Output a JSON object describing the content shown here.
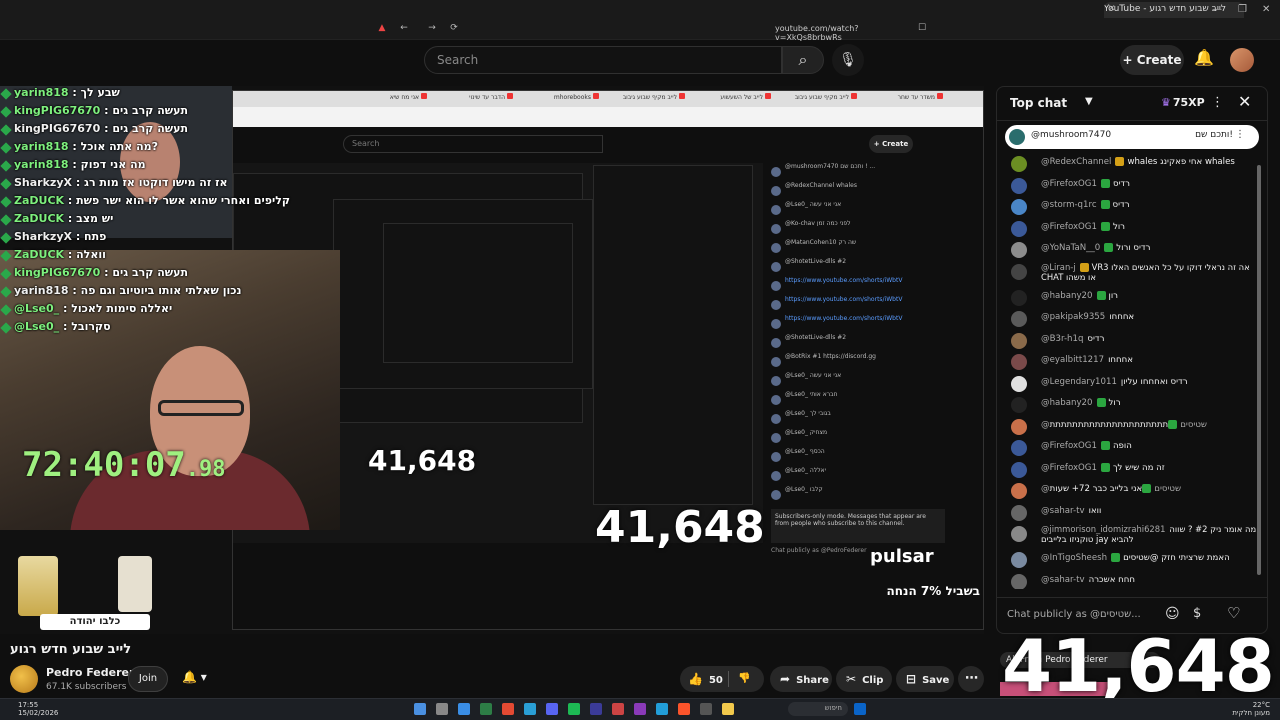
{
  "browser": {
    "tab_title": "לייב שבוע חדש רגוע - YouTube",
    "url": "youtube.com/watch?v=XkQs8brbwRs"
  },
  "masthead": {
    "search_placeholder": "Search",
    "create_label": "Create"
  },
  "video": {
    "timer_main": "72:40:07",
    "timer_frac": ".98",
    "counter_small": "41,648",
    "counter_mid": "41,648",
    "pulsar_name": "pulsar",
    "pulsar_promo": "בשביל 7% הנחה",
    "kalbi_text": "כלבו יהודה",
    "inner_search": "Search",
    "inner_create": "+ Create",
    "inner_tabs": [
      "משדר עד שחר",
      "לייב מקיף שבוע גיבוב",
      "לייב של השעשוע",
      "לייב מקיף שבוע גיבוב",
      "mhorebooks",
      "הדבר עד שינוי",
      "אני מח שיא"
    ],
    "inner_chat": [
      {
        "text": "@mushroom7470 ותכם שם ! ...",
        "kind": "pin"
      },
      {
        "text": "@RedexChannel whales",
        "kind": "normal"
      },
      {
        "text": "@Lse0_ אני אני עשה",
        "kind": "normal"
      },
      {
        "text": "@Ko-chav לפני כמה זמן",
        "kind": "normal"
      },
      {
        "text": "@MatanCohen10 שה רק",
        "kind": "normal"
      },
      {
        "text": "@ShotetLive-dlls #2",
        "kind": "normal"
      },
      {
        "text": "https://www.youtube.com/shorts/iWbtV",
        "kind": "link"
      },
      {
        "text": "https://www.youtube.com/shorts/iWbtV",
        "kind": "link"
      },
      {
        "text": "https://www.youtube.com/shorts/iWbtV",
        "kind": "link"
      },
      {
        "text": "@ShotetLive-dlls #2",
        "kind": "normal"
      },
      {
        "text": "@BotRix #1 https://discord.gg",
        "kind": "normal"
      },
      {
        "text": "@Lse0_ אני אני עשה",
        "kind": "normal"
      },
      {
        "text": "@Lse0_ חברא אותי",
        "kind": "normal"
      },
      {
        "text": "@Lse0_ בגובי לך",
        "kind": "normal"
      },
      {
        "text": "@Lse0_ מצחיק",
        "kind": "normal"
      },
      {
        "text": "@Lse0_ הכסף",
        "kind": "normal"
      },
      {
        "text": "@Lse0_ יאללה",
        "kind": "normal"
      },
      {
        "text": "@Lse0_ קלבו",
        "kind": "normal"
      }
    ],
    "inner_chat_notice": "Subscribers-only mode. Messages that appear are from people who subscribe to this channel.",
    "inner_chat_input": "Chat publicly as @PedroFederer"
  },
  "overlay_chat": [
    {
      "name": "yarin818",
      "text": "שבע לך"
    },
    {
      "name": "kingPIG67670",
      "text": "תעשה קרב גים"
    },
    {
      "name": "kingPIG67670",
      "text": "תעשה קרב גים"
    },
    {
      "name": "yarin818",
      "text": "מה אתה אוכל?"
    },
    {
      "name": "yarin818",
      "text": "מה אני דפוק"
    },
    {
      "name": "SharkzyX",
      "text": "אז זה מישו דוקטו אז מות רג"
    },
    {
      "name": "ZaDUCK",
      "text": "קליפים ואחרי שהוא אשר לו הוא ישר פשת"
    },
    {
      "name": "ZaDUCK",
      "text": "יש מצב"
    },
    {
      "name": "SharkzyX",
      "text": "פתח"
    },
    {
      "name": "ZaDUCK",
      "text": "וואלה"
    },
    {
      "name": "kingPIG67670",
      "text": "תעשה קרב גים"
    },
    {
      "name": "yarin818",
      "text": "נכון שאלתי אותו ביוטיוב וגם פה"
    },
    {
      "name": "@Lse0_",
      "text": "יאללה סימות לאכול"
    },
    {
      "name": "@Lse0_",
      "text": "סקרובל"
    }
  ],
  "chat": {
    "title": "Top chat",
    "xp": "75XP",
    "pinned": {
      "author": "@mushroom7470",
      "text": "!ותכם שם"
    },
    "messages": [
      {
        "author": "@RedexChannel",
        "text": "whales אחי פאקינג whales",
        "av": "#6b8e23",
        "badge": "#d4a017",
        "mem": false
      },
      {
        "author": "@FirefoxOG1",
        "text": "רדיס",
        "av": "#3b5998",
        "badge": "#2ba640",
        "mem": false
      },
      {
        "author": "@storm-q1rc",
        "text": "רדיס",
        "av": "#4a86c7",
        "badge": "#2ba640",
        "mem": false
      },
      {
        "author": "@FirefoxOG1",
        "text": "רול",
        "av": "#3b5998",
        "badge": "#2ba640",
        "mem": false
      },
      {
        "author": "@YoNaTaN__0",
        "text": "רדיס ורול",
        "av": "#8c8c8c",
        "badge": "#2ba640",
        "mem": false
      },
      {
        "author": "@Liran-j",
        "text": "אה זה נראלי דוקו על כל האנשים האלו VR3 או משהו CHAT",
        "av": "#444",
        "badge": "#d4a017",
        "mem": false,
        "two": true
      },
      {
        "author": "@habany20",
        "text": "רון",
        "av": "#222",
        "badge": "#2ba640",
        "mem": false
      },
      {
        "author": "@pakipak9355",
        "text": "אחחחו",
        "av": "#5a5a5a",
        "badge": "",
        "mem": false
      },
      {
        "author": "@B3r-h1q",
        "text": "רדיס",
        "av": "#8a6a4a",
        "badge": "",
        "mem": false
      },
      {
        "author": "@eyalbitt1217",
        "text": "אחחחו",
        "av": "#7a4a4a",
        "badge": "",
        "mem": false
      },
      {
        "author": "@Legendary1011",
        "text": "רדיס ואחחחו עליון",
        "av": "#e0e0e0",
        "badge": "",
        "mem": false
      },
      {
        "author": "@habany20",
        "text": "רול",
        "av": "#222",
        "badge": "#2ba640",
        "mem": false
      },
      {
        "author": "@שטיסים",
        "text": "תתתתתתתתתתתתתתתתתתתתת",
        "av": "#c9704a",
        "badge": "#2ba640",
        "mem": false
      },
      {
        "author": "@FirefoxOG1",
        "text": "הופה",
        "av": "#3b5998",
        "badge": "#2ba640",
        "mem": false
      },
      {
        "author": "@FirefoxOG1",
        "text": "זה מה שיש לך",
        "av": "#3b5998",
        "badge": "#2ba640",
        "mem": false
      },
      {
        "author": "@שטיסים",
        "text": "אני בלייב כבר 72+ שעות",
        "av": "#c9704a",
        "badge": "#2ba640",
        "mem": false
      },
      {
        "author": "@sahar-tv",
        "text": "וואו",
        "av": "#666",
        "badge": "",
        "mem": false
      },
      {
        "author": "@jimmorison_idomizrahi6281",
        "text": "מה אומר ניק #2 ? שווה להביא jay טוקניזו בלייבים",
        "av": "#888",
        "badge": "",
        "mem": false,
        "two": true
      },
      {
        "author": "@InTigoSheesh",
        "text": "האמת שרציתי חזק @שטיסים",
        "av": "#7a8aa0",
        "badge": "#2ba640",
        "mem": false
      },
      {
        "author": "@sahar-tv",
        "text": "חחח אשכרה",
        "av": "#666",
        "badge": "",
        "mem": false
      }
    ],
    "input_placeholder": "Chat publicly as @שטיסים..."
  },
  "below": {
    "title": "לייב שבוע חדש רגוע",
    "channel_name": "Pedro Federer",
    "subscribers": "67.1K subscribers",
    "join_label": "Join",
    "like_count": "50",
    "share_label": "Share",
    "clip_label": "Clip",
    "save_label": "Save"
  },
  "big_counter": "41,648",
  "from_label": "All   From Pedro Federer",
  "taskbar": {
    "time": "17:55",
    "date": "15/02/2026",
    "search": "חיפוש",
    "weather": "22°C",
    "weather_desc": "מעונן חלקית"
  }
}
